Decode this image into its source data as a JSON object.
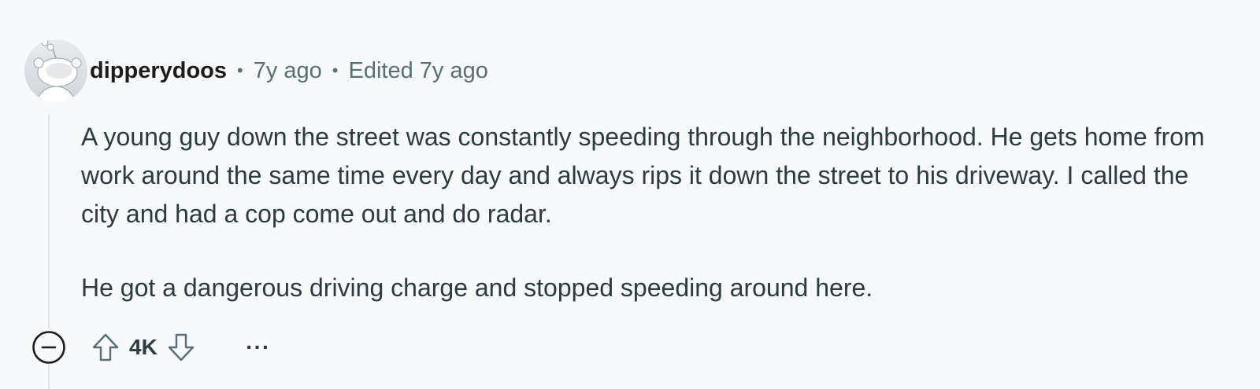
{
  "comment": {
    "author": "dipperydoos",
    "age": "7y ago",
    "edited": "Edited 7y ago",
    "separator": "•",
    "paragraphs": [
      "A young guy down the street was constantly speeding through the neighborhood. He gets home from work around the same time every day and always rips it down the street to his driveway. I called the city and had a cop come out and do radar.",
      "He got a dangerous driving charge and stopped speeding around here."
    ],
    "score": "4K",
    "more_label": "···"
  },
  "colors": {
    "background": "#f8f9fb",
    "username": "#1c1c1c",
    "meta": "#576f76",
    "body_text": "#2a3c42",
    "thread_line": "#dfe3e8"
  },
  "icons": {
    "avatar": "snoo-avatar-icon",
    "collapse": "minus-circle-icon",
    "upvote": "upvote-arrow-icon",
    "downvote": "downvote-arrow-icon",
    "more": "more-options-icon"
  }
}
